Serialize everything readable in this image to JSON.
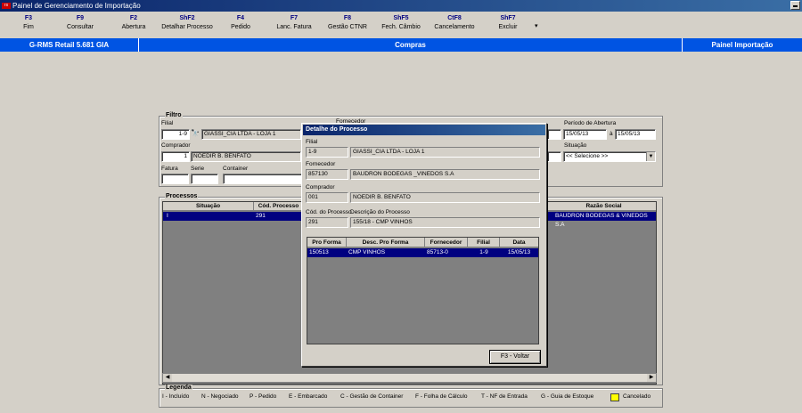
{
  "window": {
    "title": "Painel de Gerenciamento de Importação",
    "app_icon": "app-icon"
  },
  "toolbar": [
    {
      "key": "F3",
      "label": "Fim"
    },
    {
      "key": "F9",
      "label": "Consultar"
    },
    {
      "key": "F2",
      "label": "Abertura"
    },
    {
      "key": "ShF2",
      "label": "Detalhar Processo"
    },
    {
      "key": "F4",
      "label": "Pedido"
    },
    {
      "key": "F7",
      "label": "Lanc. Fatura"
    },
    {
      "key": "F8",
      "label": "Gestão CTNR"
    },
    {
      "key": "ShF5",
      "label": "Fech. Câmbio"
    },
    {
      "key": "CtF8",
      "label": "Cancelamento"
    },
    {
      "key": "ShF7",
      "label": "Excluir"
    }
  ],
  "toolbar_more": "▾",
  "header": {
    "left": "G-RMS Retail 5.681 GIA",
    "center": "Compras",
    "right": "Painel Importação"
  },
  "filtro": {
    "title": "Filtro",
    "filial_label": "Filial",
    "filial_code": "1-9",
    "filial_name": "GIASSI_CIA LTDA - LOJA 1",
    "fornecedor_label": "Fornecedor",
    "comprador_label": "Comprador",
    "comprador_code": "1",
    "comprador_name": "NOEDIR B. BENFATO",
    "fatura_label": "Fatura",
    "serie_label": "Serie",
    "container_label": "Container",
    "periodo_label": "Período de Abertura",
    "periodo_de": "15/05/13",
    "periodo_sep": "à",
    "periodo_ate": "15/05/13",
    "situacao_label": "Situação",
    "situacao_value": "<< Selecione >>"
  },
  "processos": {
    "title": "Processos",
    "columns": {
      "situacao": "Situação",
      "cod_processo": "Cód. Processo",
      "razao_social": "Razão Social"
    },
    "row": {
      "situacao": "I",
      "cod_processo": "291",
      "razao_social": "BAUDRON BODEGAS & VINEDOS S.A"
    }
  },
  "legenda": {
    "title": "Legenda",
    "items": [
      "I - Incluído",
      "N - Negociado",
      "P - Pedido",
      "E - Embarcado",
      "C - Gestão de Container",
      "F - Folha de Cálculo",
      "T - NF de Entrada",
      "G - Guia de Estoque"
    ],
    "cancelado": "Cancelado",
    "cancelado_color": "#ffff00"
  },
  "dialog": {
    "title": "Detalhe do Processo",
    "filial_label": "Filial",
    "filial_code": "1-9",
    "filial_name": "GIASSI_CIA LTDA - LOJA 1",
    "fornecedor_label": "Fornecedor",
    "fornecedor_code": "857130",
    "fornecedor_name": "BAUDRON BODEGAS _VINEDOS S.A",
    "comprador_label": "Comprador",
    "comprador_code": "001",
    "comprador_name": "NOEDIR B. BENFATO",
    "cod_label": "Cód. do Processo",
    "desc_label": "Descrição do Processo",
    "cod_value": "291",
    "desc_value": "155/18 - CMP VINHOS",
    "columns": {
      "pro_forma": "Pro Forma",
      "desc": "Desc. Pro Forma",
      "fornecedor": "Fornecedor",
      "filial": "Filial",
      "data": "Data"
    },
    "row": {
      "pro_forma": "150513",
      "desc": "CMP VINHOS",
      "fornecedor": "85713-0",
      "filial": "1-9",
      "data": "15/05/13"
    },
    "button": "F3 - Voltar"
  },
  "colors": {
    "header_blue": "#0054e3",
    "selection": "#000080",
    "title_gradient_start": "#0a246a"
  }
}
